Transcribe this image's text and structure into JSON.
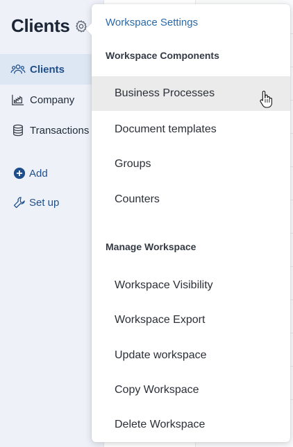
{
  "sidebar": {
    "title": "Clients",
    "items": [
      {
        "label": "Clients",
        "icon": "users-icon",
        "active": true
      },
      {
        "label": "Company",
        "icon": "chart-icon",
        "active": false
      },
      {
        "label": "Transactions",
        "icon": "database-icon",
        "active": false
      }
    ],
    "actions": [
      {
        "label": "Add",
        "icon": "plus-circle-icon"
      },
      {
        "label": "Set up",
        "icon": "wrench-icon"
      }
    ]
  },
  "dropdown": {
    "header_link": "Workspace Settings",
    "sections": [
      {
        "title": "Workspace Components",
        "items": [
          "Business Processes",
          "Document templates",
          "Groups",
          "Counters"
        ]
      },
      {
        "title": "Manage Workspace",
        "items": [
          "Workspace Visibility",
          "Workspace Export",
          "Update workspace",
          "Copy Workspace",
          "Delete Workspace"
        ]
      }
    ],
    "hovered_item": "Business Processes"
  },
  "colors": {
    "accent": "#1f4f8a",
    "link": "#2a6aa8",
    "sidebar_bg": "#eef2f8",
    "hover_bg": "#ebebeb"
  }
}
